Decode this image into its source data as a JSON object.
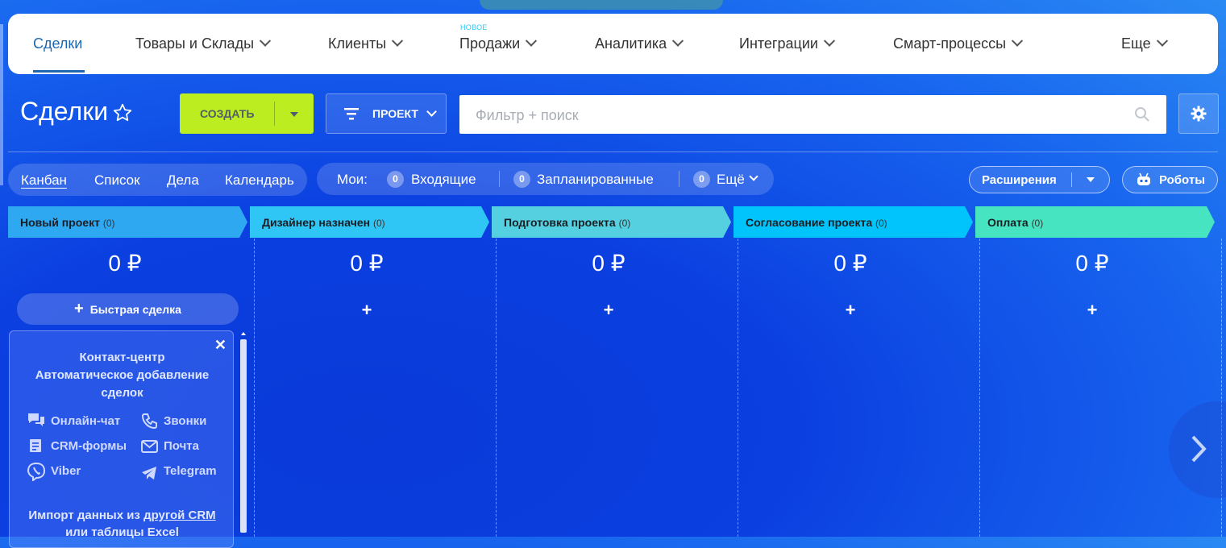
{
  "nav": {
    "items": [
      {
        "label": "Сделки",
        "active": true
      },
      {
        "label": "Товары и Склады"
      },
      {
        "label": "Клиенты"
      },
      {
        "label": "Продажи",
        "badge": "НОВОЕ"
      },
      {
        "label": "Аналитика"
      },
      {
        "label": "Интеграции"
      },
      {
        "label": "Смарт-процессы"
      },
      {
        "label": "Еще"
      }
    ]
  },
  "toolbar": {
    "title": "Сделки",
    "create_label": "СОЗДАТЬ",
    "project_label": "ПРОЕКТ",
    "search_placeholder": "Фильтр + поиск"
  },
  "views": {
    "items": [
      "Канбан",
      "Список",
      "Дела",
      "Календарь"
    ],
    "active": "Канбан"
  },
  "counters": {
    "label": "Мои:",
    "items": [
      {
        "count": "0",
        "label": "Входящие"
      },
      {
        "count": "0",
        "label": "Запланированные"
      },
      {
        "count": "0",
        "label": "Ещё"
      }
    ]
  },
  "actions": {
    "extensions": "Расширения",
    "robots": "Роботы"
  },
  "stages": [
    {
      "title": "Новый проект",
      "count": "(0)",
      "sum": "0 ₽",
      "color": "#2fa8f2"
    },
    {
      "title": "Дизайнер назначен",
      "count": "(0)",
      "sum": "0 ₽",
      "color": "#2fc6f6"
    },
    {
      "title": "Подготовка проекта",
      "count": "(0)",
      "sum": "0 ₽",
      "color": "#55d0e0"
    },
    {
      "title": "Согласование проекта",
      "count": "(0)",
      "sum": "0 ₽",
      "color": "#00c4fb"
    },
    {
      "title": "Оплата",
      "count": "(0)",
      "sum": "0 ₽",
      "color": "#47e4c2"
    }
  ],
  "quick_deal": {
    "label": "Быстрая сделка",
    "plus": "+"
  },
  "promo": {
    "title_lines": [
      "Контакт-центр",
      "Автоматическое добавление",
      "сделок"
    ],
    "channels": [
      "Онлайн-чат",
      "Звонки",
      "CRM-формы",
      "Почта",
      "Viber",
      "Telegram"
    ],
    "import_prefix": "Импорт данных из ",
    "import_link": "другой CRM",
    "import_line2": "или таблицы Excel"
  }
}
